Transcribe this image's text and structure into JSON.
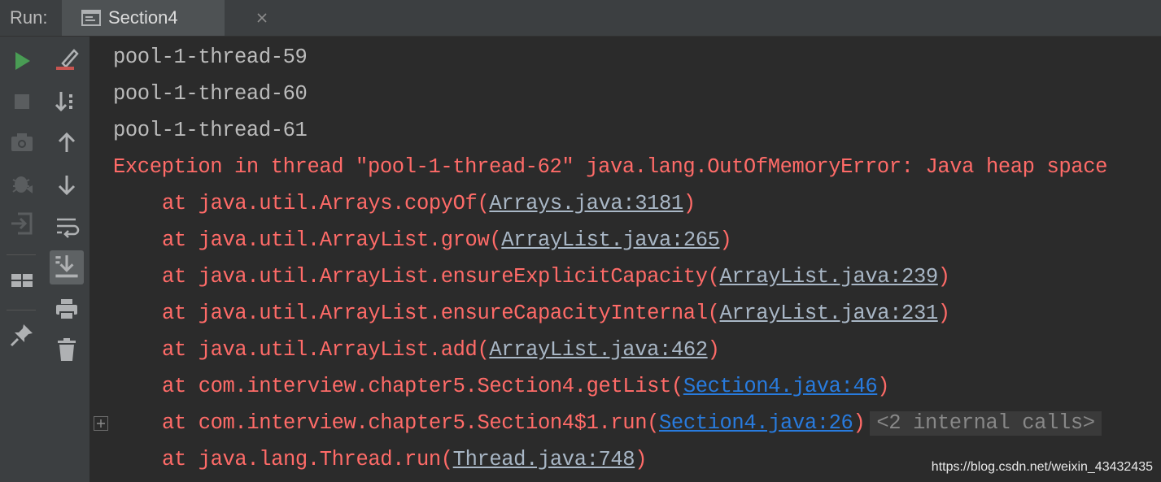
{
  "header": {
    "run_label": "Run:",
    "tab": {
      "label": "Section4",
      "icon": "console-window-icon",
      "close_icon": "close-icon"
    }
  },
  "toolbar_left": [
    {
      "name": "rerun-icon",
      "color": "#499c54"
    },
    {
      "name": "stop-icon"
    },
    {
      "name": "camera-icon"
    },
    {
      "name": "debug-bug-icon"
    },
    {
      "name": "login-icon"
    },
    {
      "name": "layout-icon"
    },
    {
      "name": "pin-icon"
    }
  ],
  "toolbar_right": [
    {
      "name": "clear-edit-icon"
    },
    {
      "name": "sort-down-icon"
    },
    {
      "name": "arrow-up-icon"
    },
    {
      "name": "arrow-down-icon"
    },
    {
      "name": "soft-wrap-icon"
    },
    {
      "name": "scroll-to-end-icon",
      "active": true
    },
    {
      "name": "print-icon"
    },
    {
      "name": "trash-icon"
    }
  ],
  "console": {
    "output": [
      "pool-1-thread-59",
      "pool-1-thread-60",
      "pool-1-thread-61"
    ],
    "exception": "Exception in thread \"pool-1-thread-62\" java.lang.OutOfMemoryError: Java heap space",
    "trace": [
      {
        "text": "at java.util.Arrays.copyOf(",
        "link": "Arrays.java:3181",
        "end": ")"
      },
      {
        "text": "at java.util.ArrayList.grow(",
        "link": "ArrayList.java:265",
        "end": ")"
      },
      {
        "text": "at java.util.ArrayList.ensureExplicitCapacity(",
        "link": "ArrayList.java:239",
        "end": ")"
      },
      {
        "text": "at java.util.ArrayList.ensureCapacityInternal(",
        "link": "ArrayList.java:231",
        "end": ")"
      },
      {
        "text": "at java.util.ArrayList.add(",
        "link": "ArrayList.java:462",
        "end": ")"
      },
      {
        "text": "at com.interview.chapter5.Section4.getList(",
        "link": "Section4.java:46",
        "end": ")"
      },
      {
        "text": "at com.interview.chapter5.Section4$1.run(",
        "link": "Section4.java:26",
        "end": ")",
        "folded": "<2 internal calls>"
      },
      {
        "text": "at java.lang.Thread.run(",
        "link": "Thread.java:748",
        "end": ")"
      }
    ]
  },
  "colors": {
    "error": "#ff6b68",
    "normal": "#bbbbbb",
    "user_link": "#287bde"
  },
  "watermark": "https://blog.csdn.net/weixin_43432435"
}
